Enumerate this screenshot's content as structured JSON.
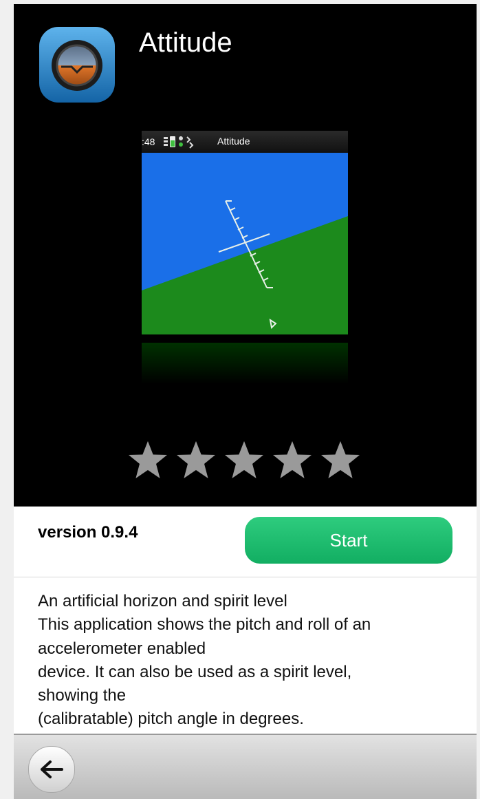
{
  "app": {
    "title": "Attitude",
    "icon": "attitude-indicator-app-icon"
  },
  "screenshot": {
    "status_time": ":48",
    "status_icons": "signal-battery-status-icons",
    "title": "Attitude"
  },
  "rating": {
    "max": 5,
    "stars": [
      "star-icon",
      "star-icon",
      "star-icon",
      "star-icon",
      "star-icon"
    ]
  },
  "info": {
    "version": "version 0.9.4",
    "start_label": "Start"
  },
  "description": {
    "lines": [
      "An artificial horizon and spirit level",
      "This application shows the pitch and roll of an",
      "accelerometer enabled",
      "device. It can also be used as a spirit level,",
      "showing the",
      "(calibratable) pitch angle in degrees."
    ]
  },
  "toolbar": {
    "back_icon": "back-arrow-icon"
  },
  "colors": {
    "accent": "#1bbd6d",
    "sky": "#1a6fe8",
    "ground": "#1c8a1c"
  }
}
